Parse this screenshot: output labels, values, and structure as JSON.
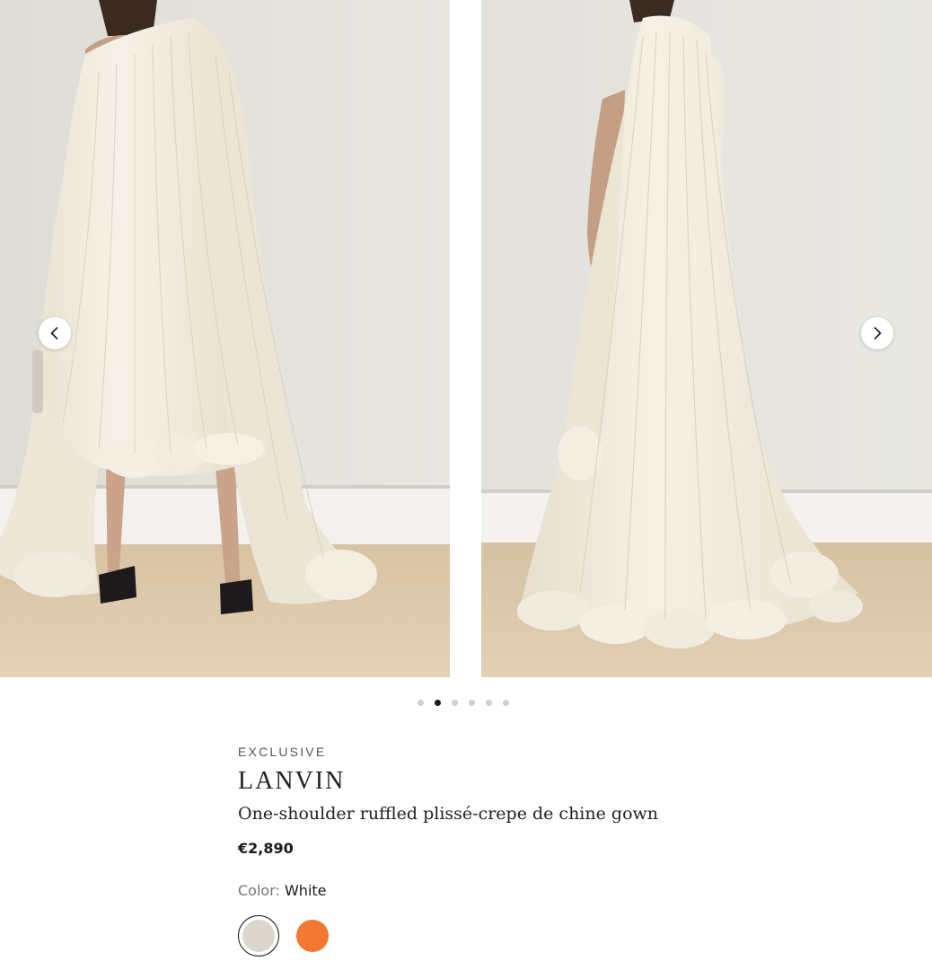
{
  "gallery": {
    "images": [
      {
        "alt": "model front view"
      },
      {
        "alt": "model side view"
      }
    ],
    "prev_icon": "chevron-left-icon",
    "next_icon": "chevron-right-icon",
    "dot_count": 6,
    "active_dot": 2
  },
  "product": {
    "eyebrow": "EXCLUSIVE",
    "brand": "LANVIN",
    "name": "One-shoulder ruffled plissé-crepe de chine gown",
    "price": "€2,890",
    "color_label": "Color:",
    "color_value": "White",
    "swatches": [
      {
        "name": "White",
        "color": "#dcd7cc",
        "selected": true
      },
      {
        "name": "Orange",
        "color": "#f27730",
        "selected": false
      }
    ]
  }
}
